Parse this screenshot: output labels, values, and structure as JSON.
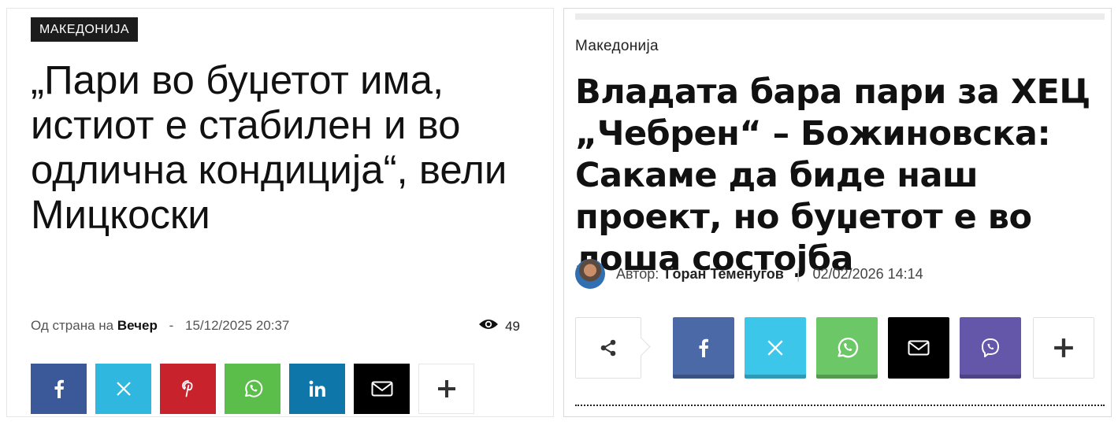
{
  "left": {
    "category": "МАКЕДОНИЈА",
    "headline": "„Пари во буџетот има, истиот е стабилен и во одлична кондиција“, вели Мицкоски",
    "byline_prefix": "Од страна на",
    "author": "Вечер",
    "separator": "-",
    "date": "15/12/2025 20:37",
    "views": "49",
    "share_buttons": [
      {
        "name": "facebook",
        "icon": "facebook-icon",
        "color": "#3b5998"
      },
      {
        "name": "x",
        "icon": "x-icon",
        "color": "#2fb7e0"
      },
      {
        "name": "pinterest",
        "icon": "pinterest-icon",
        "color": "#c8232c"
      },
      {
        "name": "whatsapp",
        "icon": "whatsapp-icon",
        "color": "#5cbe4a"
      },
      {
        "name": "linkedin",
        "icon": "linkedin-icon",
        "color": "#0e76a8"
      },
      {
        "name": "email",
        "icon": "email-icon",
        "color": "#000000"
      },
      {
        "name": "more",
        "icon": "plus-icon",
        "color": "#ffffff"
      }
    ]
  },
  "right": {
    "category": "Македонија",
    "headline": "Владата бара пари за ХЕЦ „Чебрен“ – Божиновска: Сакаме да биде наш проект, но буџетот е во лоша состојба",
    "author_label": "Автор:",
    "author": "Горан Теменугов",
    "date": "02/02/2026 14:14",
    "share_buttons": [
      {
        "name": "share",
        "icon": "share-icon",
        "color": "#ffffff"
      },
      {
        "name": "facebook",
        "icon": "facebook-icon",
        "color": "#4b69a6"
      },
      {
        "name": "x",
        "icon": "x-icon",
        "color": "#3bc6ea"
      },
      {
        "name": "whatsapp",
        "icon": "whatsapp-icon",
        "color": "#6cc766"
      },
      {
        "name": "email",
        "icon": "email-icon",
        "color": "#000000"
      },
      {
        "name": "viber",
        "icon": "viber-icon",
        "color": "#6456a9"
      },
      {
        "name": "more",
        "icon": "plus-icon",
        "color": "#ffffff"
      }
    ]
  }
}
